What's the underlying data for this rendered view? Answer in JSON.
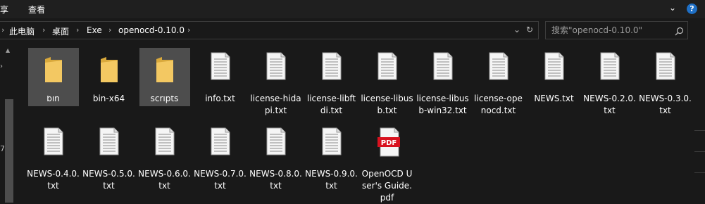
{
  "ribbon": {
    "menu": [
      "享",
      "查看"
    ],
    "expand_glyph": "⌄",
    "help_glyph": "?"
  },
  "address": {
    "crumbs": [
      "此电脑",
      "桌面",
      "Exe",
      "openocd-0.10.0"
    ],
    "separator": "›",
    "dropdown_glyph": "⌄",
    "refresh_glyph": "↻"
  },
  "search": {
    "placeholder": "搜索\"openocd-0.10.0\""
  },
  "files": [
    {
      "name": "bin",
      "kind": "folder",
      "selected": true
    },
    {
      "name": "bin-x64",
      "kind": "folder",
      "selected": false
    },
    {
      "name": "scripts",
      "kind": "folder",
      "selected": true
    },
    {
      "name": "info.txt",
      "kind": "text"
    },
    {
      "name": "license-hidapi.txt",
      "kind": "text"
    },
    {
      "name": "license-libftdi.txt",
      "kind": "text"
    },
    {
      "name": "license-libusb.txt",
      "kind": "text"
    },
    {
      "name": "license-libusb-win32.txt",
      "kind": "text"
    },
    {
      "name": "license-openocd.txt",
      "kind": "text"
    },
    {
      "name": "NEWS.txt",
      "kind": "text"
    },
    {
      "name": "NEWS-0.2.0.txt",
      "kind": "text"
    },
    {
      "name": "NEWS-0.3.0.txt",
      "kind": "text"
    },
    {
      "name": "NEWS-0.4.0.txt",
      "kind": "text"
    },
    {
      "name": "NEWS-0.5.0.txt",
      "kind": "text"
    },
    {
      "name": "NEWS-0.6.0.txt",
      "kind": "text"
    },
    {
      "name": "NEWS-0.7.0.txt",
      "kind": "text"
    },
    {
      "name": "NEWS-0.8.0.txt",
      "kind": "text"
    },
    {
      "name": "NEWS-0.9.0.txt",
      "kind": "text"
    },
    {
      "name": "OpenOCD User's Guide.pdf",
      "kind": "pdf",
      "badge": "PDF"
    }
  ],
  "colors": {
    "background": "#191919",
    "selection": "#4d4d4d",
    "folder": "#f3c862",
    "pdf_badge": "#d8121f"
  }
}
